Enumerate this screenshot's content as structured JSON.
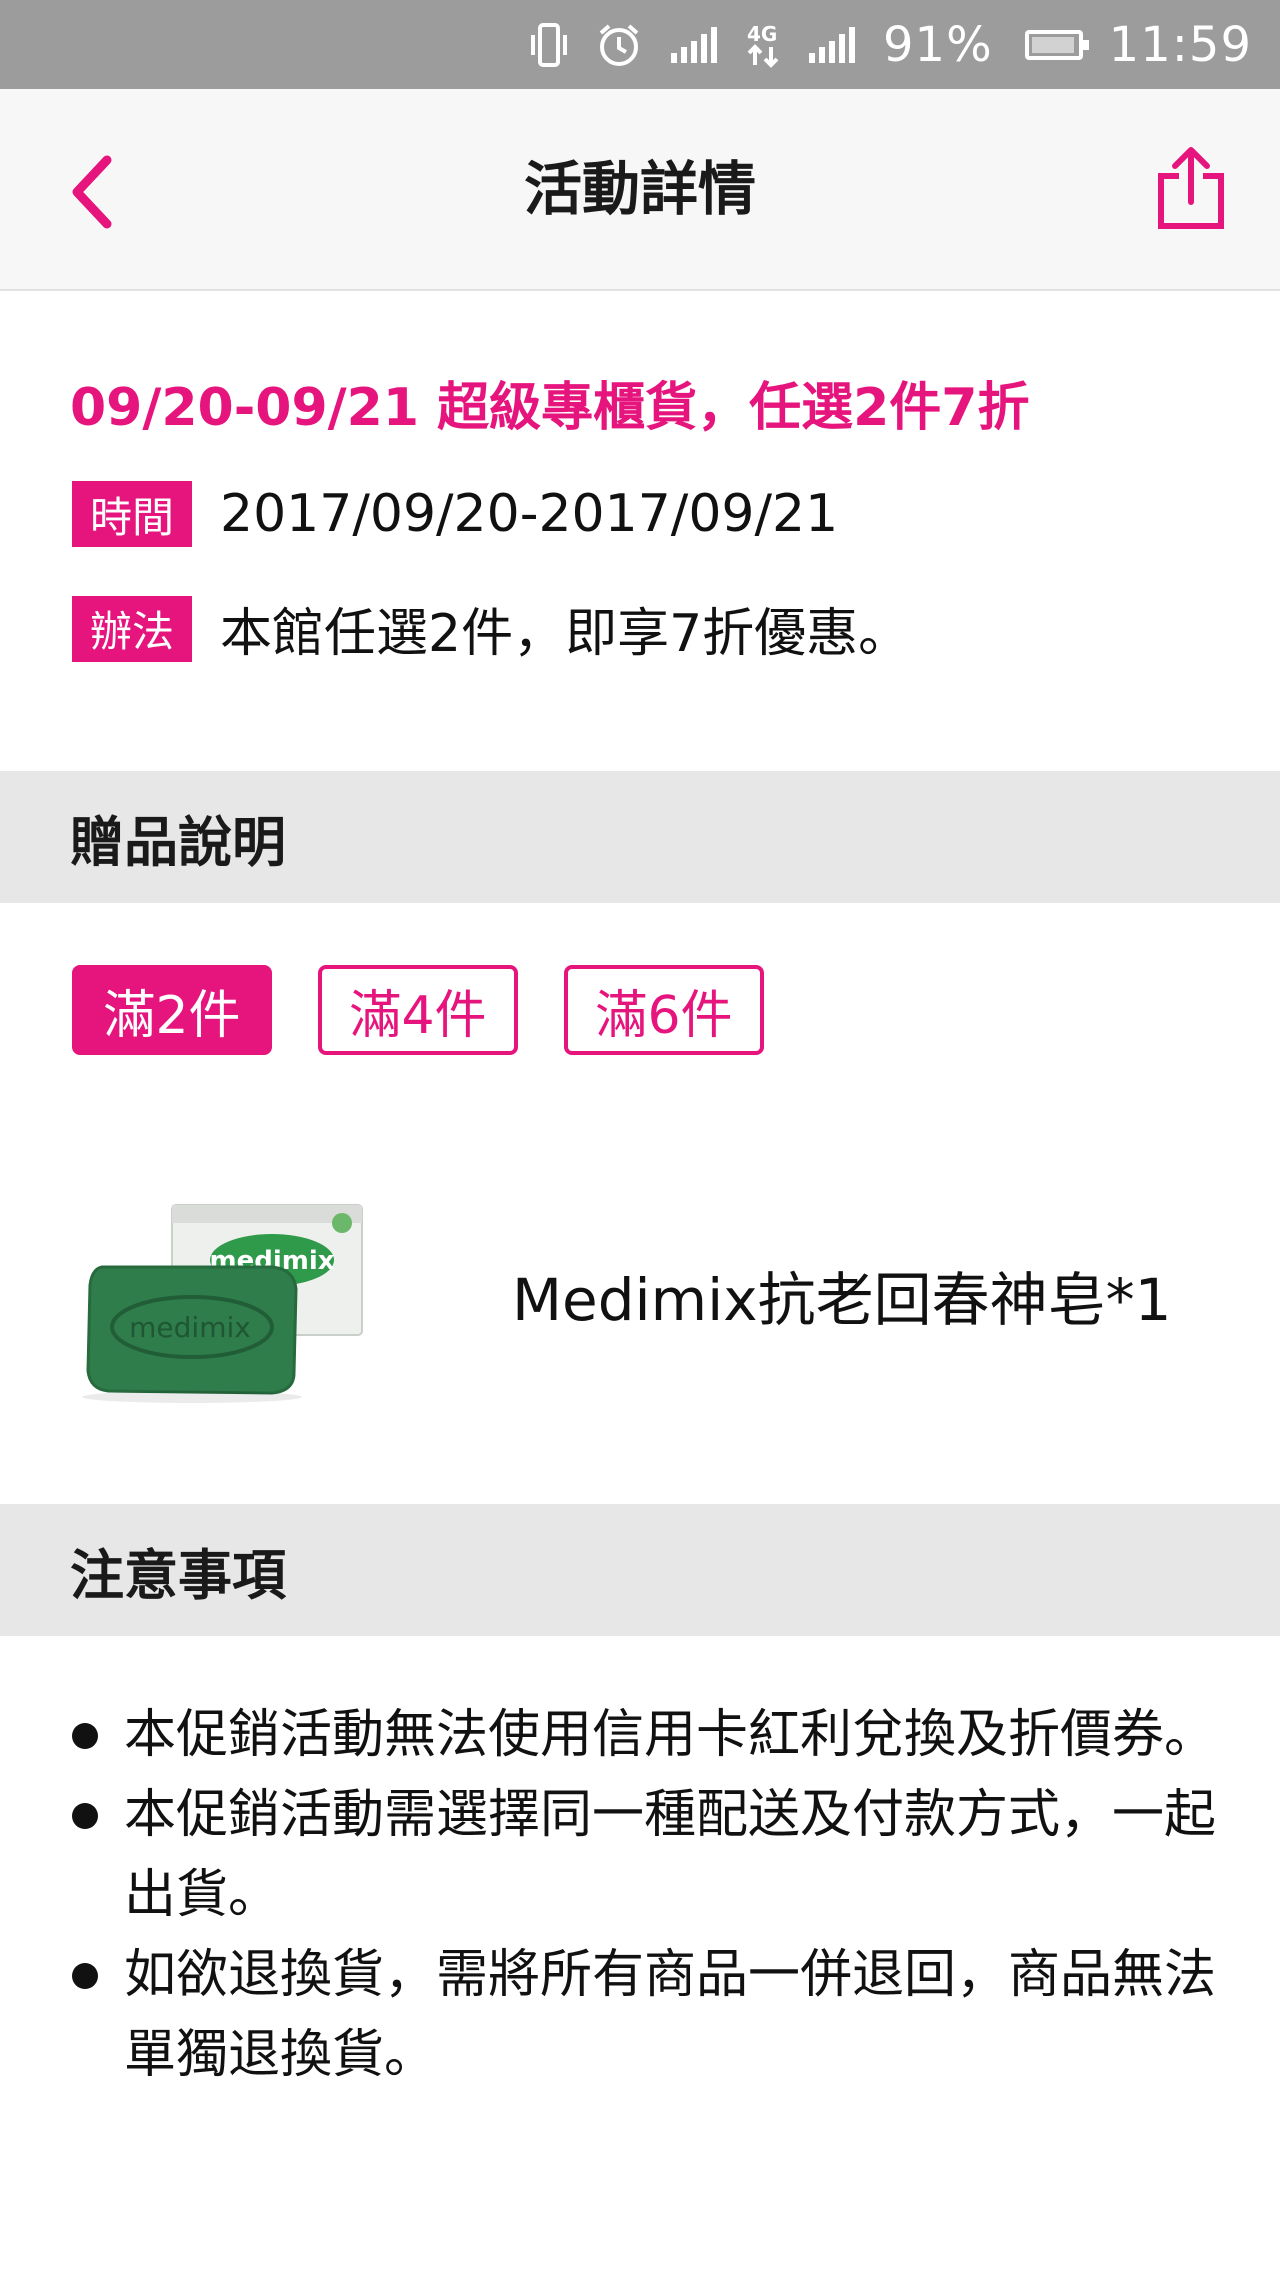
{
  "status_bar": {
    "battery": "91%",
    "time": "11:59",
    "icons": [
      "vibrate-icon",
      "alarm-icon",
      "signal-icon",
      "4g-icon",
      "signal-2-icon",
      "battery-charging-icon"
    ]
  },
  "header": {
    "title": "活動詳情",
    "back_icon": "chevron-left-icon",
    "share_icon": "share-icon"
  },
  "activity": {
    "title": "09/20-09/21 超級專櫃貨，任選2件7折",
    "time_tag": "時間",
    "time_value": "2017/09/20-2017/09/21",
    "method_tag": "辦法",
    "method_value": "本館任選2件，即享7折優惠。"
  },
  "gift_section": {
    "heading": "贈品說明",
    "tiers": [
      "滿2件",
      "滿4件",
      "滿6件"
    ],
    "active_tier": 0,
    "item": {
      "name": "Medimix抗老回春神皂*1",
      "image_text": "medimix"
    }
  },
  "notes_section": {
    "heading": "注意事項",
    "items": [
      "本促銷活動無法使用信用卡紅利兌換及折價券。",
      "本促銷活動需選擇同一種配送及付款方式，一起出貨。",
      "如欲退換貨，需將所有商品一併退回，商品無法單獨退換貨。"
    ]
  },
  "colors": {
    "accent": "#e6157d",
    "status_bar": "#9c9c9c",
    "section_bg": "#e7e7e7",
    "header_bg": "#f7f7f7"
  }
}
